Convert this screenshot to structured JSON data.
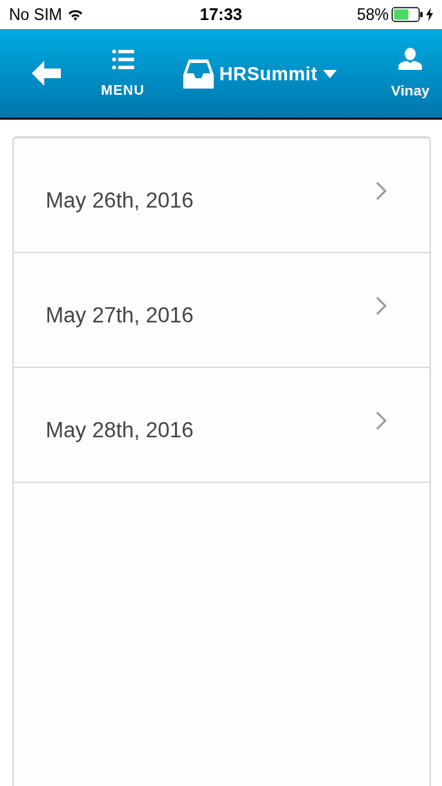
{
  "status_bar": {
    "carrier": "No SIM",
    "time": "17:33",
    "battery": "58%"
  },
  "nav_bar": {
    "menu_label": "MENU",
    "title": "HRSummit",
    "user_label": "Vinay"
  },
  "dates": [
    {
      "label": "May 26th, 2016"
    },
    {
      "label": "May 27th, 2016"
    },
    {
      "label": "May 28th, 2016"
    }
  ]
}
